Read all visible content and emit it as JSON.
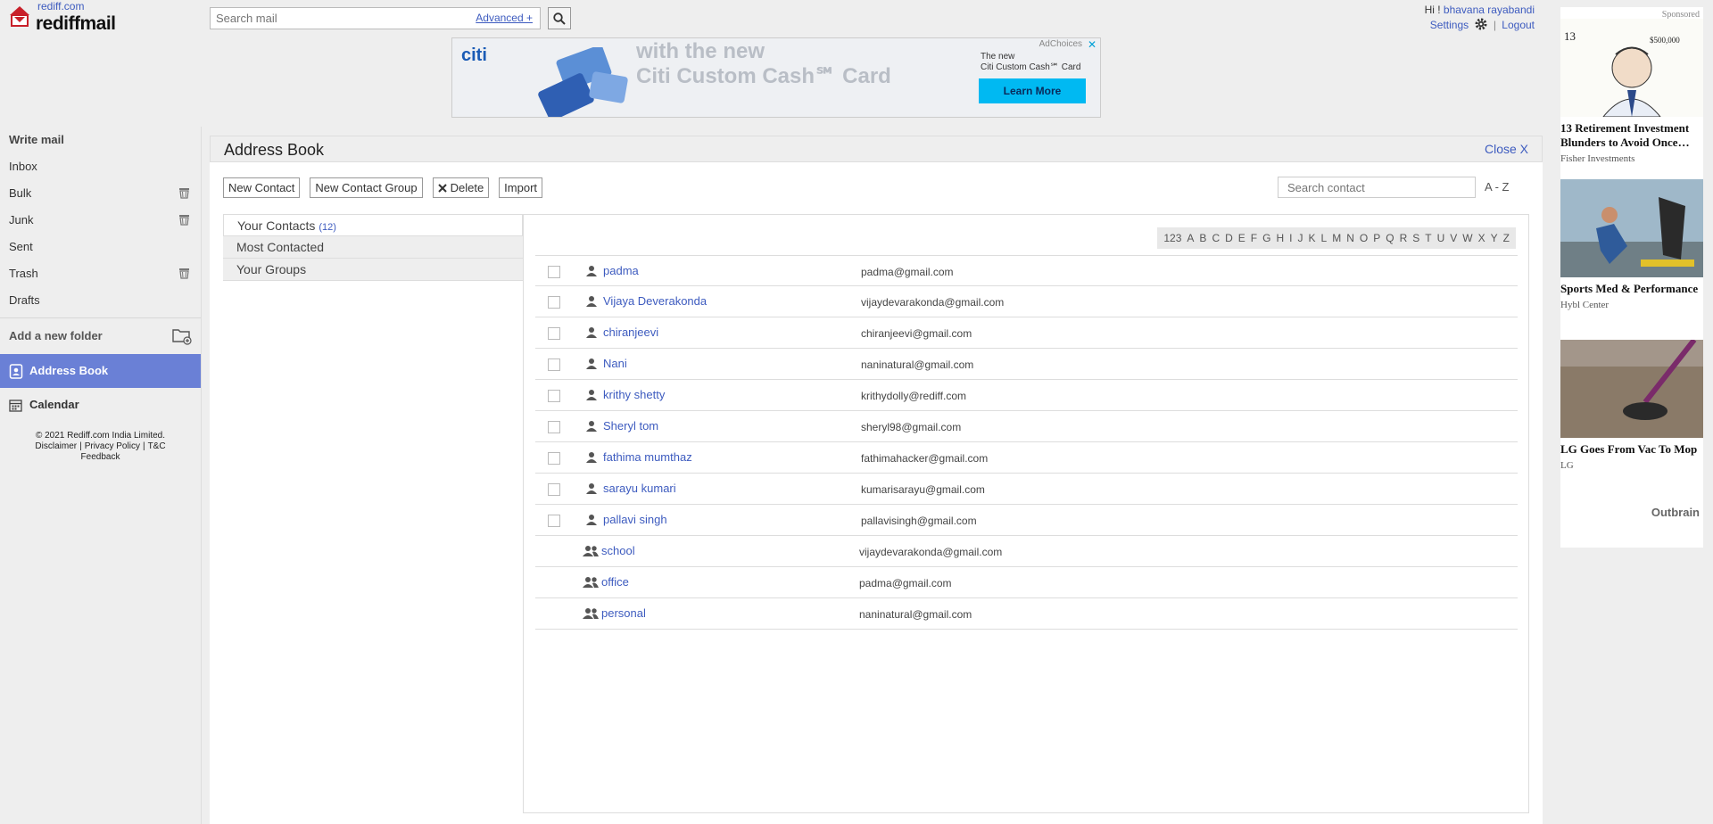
{
  "header": {
    "site_link": "rediff.com",
    "brand": "rediffmail",
    "search_placeholder": "Search mail",
    "advanced_label": "Advanced +",
    "greeting": "Hi !",
    "user_name": "bhavana rayabandi",
    "settings_label": "Settings",
    "logout_label": "Logout"
  },
  "banner": {
    "brand": "citi",
    "headline1": "with the new",
    "headline2": "Citi Custom Cash℠ Card",
    "sub1": "The new",
    "sub2": "Citi Custom Cash℠ Card",
    "cta": "Learn More",
    "adchoices": "AdChoices"
  },
  "sidebar": {
    "write_mail": "Write mail",
    "items": [
      {
        "label": "Inbox"
      },
      {
        "label": "Bulk"
      },
      {
        "label": "Junk"
      },
      {
        "label": "Sent"
      },
      {
        "label": "Trash"
      },
      {
        "label": "Drafts"
      }
    ],
    "add_folder": "Add a new folder",
    "address_book": "Address Book",
    "calendar": "Calendar",
    "footer": {
      "copyright": "© 2021 Rediff.com India Limited.",
      "disclaimer": "Disclaimer",
      "privacy": "Privacy Policy",
      "tc": "T&C",
      "feedback": "Feedback"
    }
  },
  "address_book": {
    "title": "Address Book",
    "close": "Close X",
    "toolbar": {
      "new_contact": "New Contact",
      "new_group": "New Contact Group",
      "delete": "Delete",
      "import": "Import"
    },
    "search_placeholder": "Search contact",
    "sort": "A - Z",
    "panels": {
      "your_contacts": "Your Contacts",
      "contacts_count": "(12)",
      "most_contacted": "Most Contacted",
      "your_groups": "Your Groups"
    },
    "alphabet": [
      "123",
      "A",
      "B",
      "C",
      "D",
      "E",
      "F",
      "G",
      "H",
      "I",
      "J",
      "K",
      "L",
      "M",
      "N",
      "O",
      "P",
      "Q",
      "R",
      "S",
      "T",
      "U",
      "V",
      "W",
      "X",
      "Y",
      "Z"
    ],
    "contacts": [
      {
        "name": "padma",
        "email": "padma@gmail.com"
      },
      {
        "name": "Vijaya Deverakonda",
        "email": "vijaydevarakonda@gmail.com"
      },
      {
        "name": "chiranjeevi",
        "email": "chiranjeevi@gmail.com"
      },
      {
        "name": "Nani",
        "email": "naninatural@gmail.com"
      },
      {
        "name": "krithy shetty",
        "email": "krithydolly@rediff.com"
      },
      {
        "name": "Sheryl tom",
        "email": "sheryl98@gmail.com"
      },
      {
        "name": "fathima mumthaz",
        "email": "fathimahacker@gmail.com"
      },
      {
        "name": "sarayu kumari",
        "email": "kumarisarayu@gmail.com"
      },
      {
        "name": "pallavi singh",
        "email": "pallavisingh@gmail.com"
      }
    ],
    "groups": [
      {
        "name": "school",
        "email": "vijaydevarakonda@gmail.com"
      },
      {
        "name": "office",
        "email": "padma@gmail.com"
      },
      {
        "name": "personal",
        "email": "naninatural@gmail.com"
      }
    ]
  },
  "ads": {
    "sponsored": "Sponsored",
    "items": [
      {
        "headline": "13 Retirement Investment Blunders to Avoid Once…",
        "source": "Fisher Investments",
        "image_text": "13",
        "image_amount": "$500,000"
      },
      {
        "headline": "Sports Med & Performance",
        "source": "Hybl Center"
      },
      {
        "headline": "LG Goes From Vac To Mop",
        "source": "LG"
      }
    ],
    "outbrain": "Outbrain"
  }
}
